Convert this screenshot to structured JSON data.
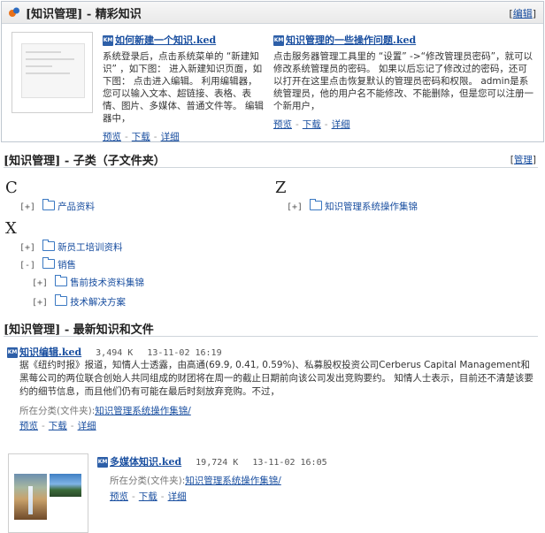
{
  "featured": {
    "title": "[知识管理] - 精彩知识",
    "edit_label": "编辑",
    "cards": [
      {
        "icon": "ked-file-icon",
        "title": "如何新建一个知识.ked",
        "desc": "系统登录后，点击系统菜单的 “新建知识” ，如下图： 进入新建知识页面，如下图： 点击进入编辑。 利用编辑器，您可以输入文本、超链接、表格、表情、图片、多媒体、普通文件等。 编辑器中，",
        "preview": "预览",
        "download": "下载",
        "detail": "详细"
      },
      {
        "icon": "ked-file-icon",
        "title": "知识管理的一些操作问题.ked",
        "desc": "点击服务器管理工具里的 “设置” ->“修改管理员密码”，就可以修改系统管理员的密码。 如果以后忘记了修改过的密码，还可以打开在这里点击恢复默认的管理员密码和权限。 admin是系统管理员，他的用户名不能修改、不能删除，但是您可以注册一个新用户，",
        "preview": "预览",
        "download": "下载",
        "detail": "详细"
      }
    ]
  },
  "subcategories": {
    "title": "[知识管理] - 子类（子文件夹）",
    "manage_label": "管理",
    "groups": [
      {
        "letter": "C",
        "items": [
          {
            "toggle": "[+]",
            "label": "产品资料"
          }
        ]
      },
      {
        "letter": "Z",
        "items": [
          {
            "toggle": "[+]",
            "label": "知识管理系统操作集锦"
          }
        ]
      },
      {
        "letter": "X",
        "items": [
          {
            "toggle": "[+]",
            "label": "新员工培训资料"
          },
          {
            "toggle": "[-]",
            "label": "销售"
          },
          {
            "toggle": "[+]",
            "label": "售前技术资料集锦"
          },
          {
            "toggle": "[+]",
            "label": "技术解决方案"
          }
        ]
      }
    ]
  },
  "latest": {
    "title": "[知识管理] - 最新知识和文件",
    "items": [
      {
        "icon": "ked-file-icon",
        "title": "知识编辑.ked",
        "size": "3,494 K",
        "date": "13-11-02 16:19",
        "desc": "据《纽约时报》报道，知情人士透露，由高通(69.9, 0.41, 0.59%)、私募股权投资公司Cerberus Capital Management和黑莓公司的两位联合创始人共同组成的财团将在周一的截止日期前向该公司发出竞购要约。 知情人士表示，目前还不清楚该要约的细节信息，而且他们仍有可能在最后时刻放弃竞购。不过，",
        "category_label": "所在分类(文件夹):",
        "category": "知识管理系统操作集锦/",
        "preview": "预览",
        "download": "下载",
        "detail": "详细"
      },
      {
        "icon": "ked-file-icon",
        "title": "多媒体知识.ked",
        "size": "19,724 K",
        "date": "13-11-02 16:05",
        "category_label": "所在分类(文件夹):",
        "category": "知识管理系统操作集锦/",
        "preview": "预览",
        "download": "下载",
        "detail": "详细"
      }
    ]
  }
}
